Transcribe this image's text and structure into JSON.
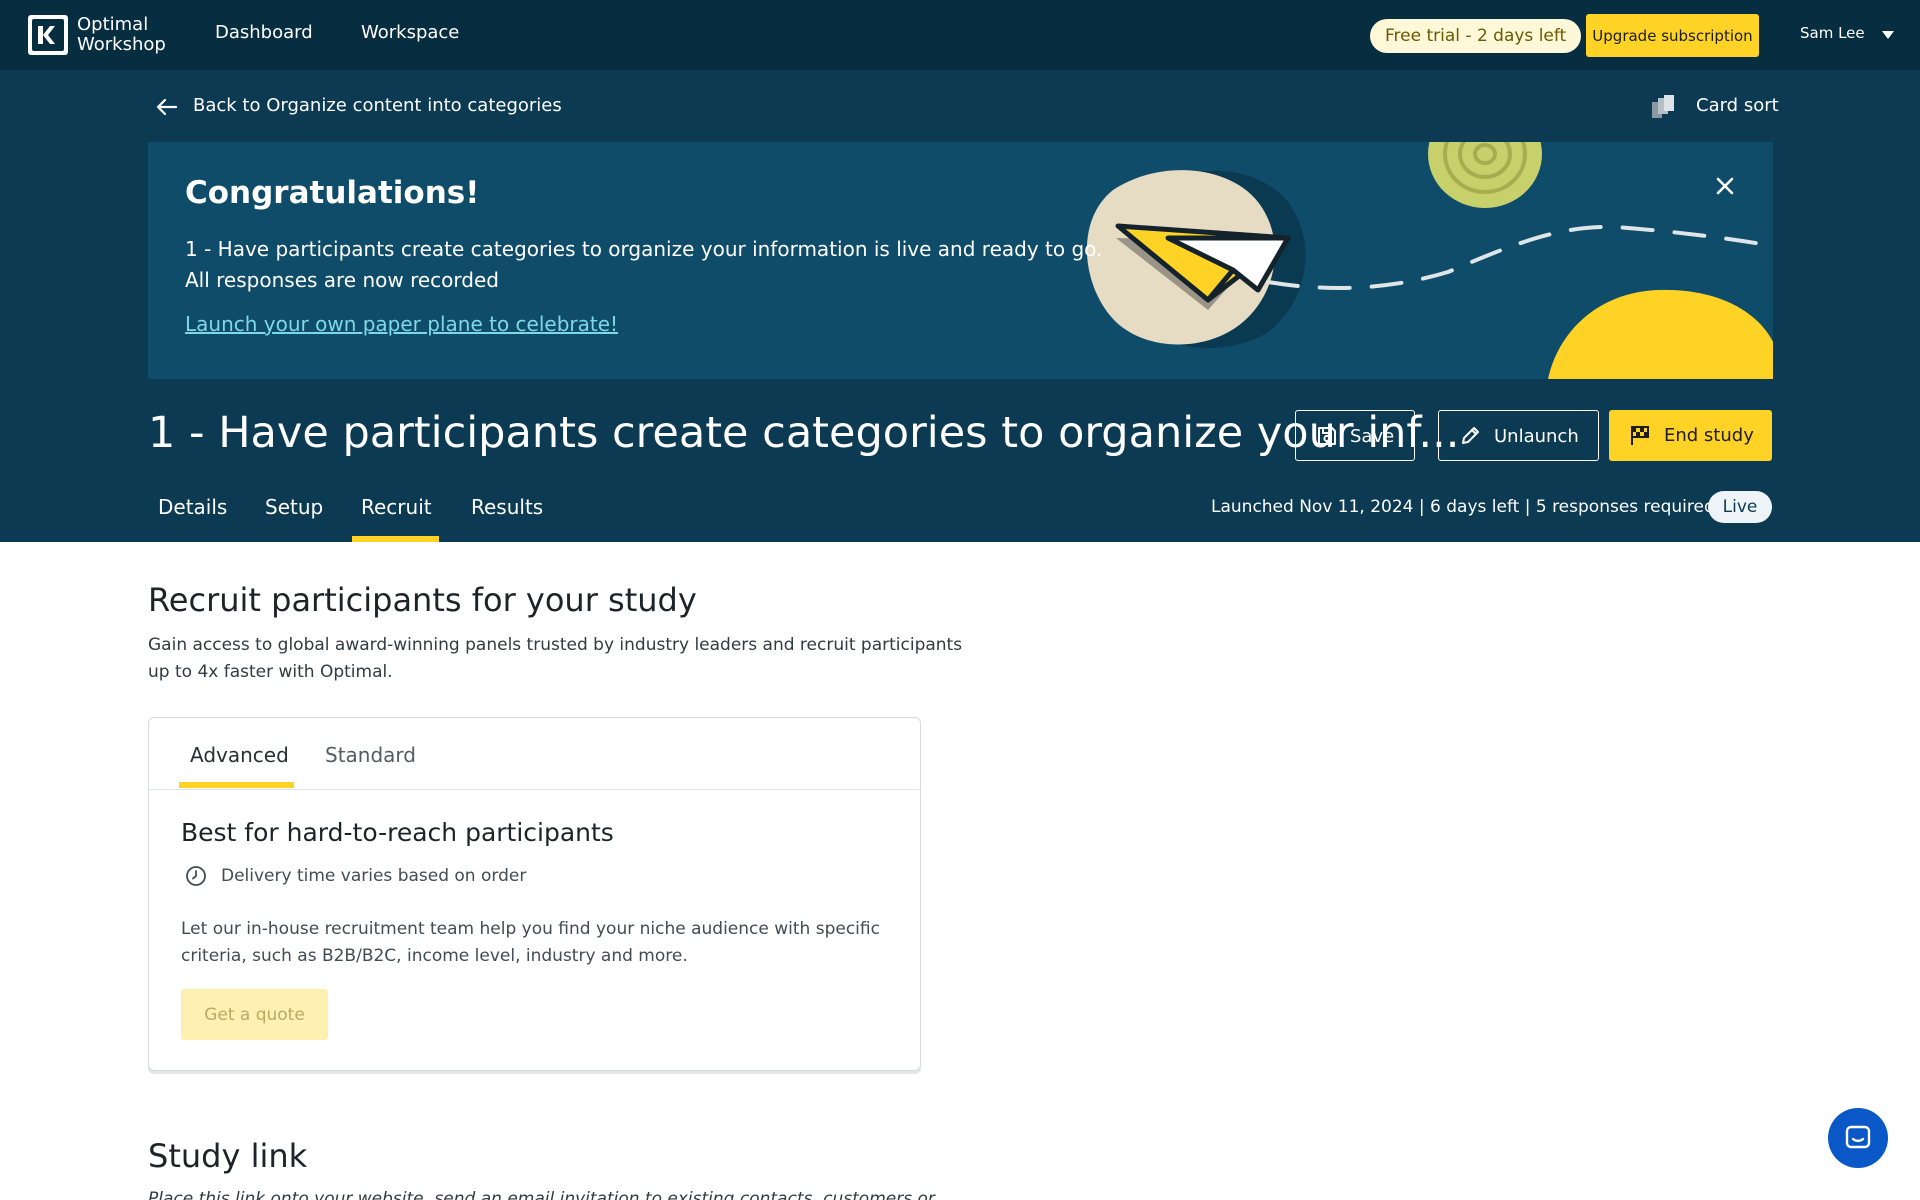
{
  "topnav": {
    "brand_line1": "Optimal",
    "brand_line2": "Workshop",
    "links": [
      "Dashboard",
      "Workspace"
    ],
    "trial_badge": "Free trial - 2 days left",
    "upgrade_label": "Upgrade subscription",
    "user_name": "Sam Lee"
  },
  "header": {
    "back_label": "Back to Organize content into categories",
    "study_type": "Card sort"
  },
  "banner": {
    "title": "Congratulations!",
    "line1": "1 - Have participants create categories to organize your information is live and ready to go.",
    "line2": "All responses are now recorded",
    "link": "Launch your own paper plane to celebrate!"
  },
  "study": {
    "title": "1 - Have participants create categories to organize your inf...",
    "save_label": "Save",
    "unlaunch_label": "Unlaunch",
    "end_label": "End study"
  },
  "tabs": {
    "items": [
      "Details",
      "Setup",
      "Recruit",
      "Results"
    ],
    "active": "Recruit",
    "meta": "Launched Nov 11, 2024 | 6 days left | 5 responses required",
    "status": "Live"
  },
  "recruit": {
    "title": "Recruit participants for your study",
    "desc_line1": "Gain access to global award-winning panels trusted by industry leaders and recruit participants",
    "desc_line2": "up to 4x faster with Optimal.",
    "card": {
      "tabs": [
        "Advanced",
        "Standard"
      ],
      "active_tab": "Advanced",
      "heading": "Best for hard-to-reach participants",
      "delivery": "Delivery time varies based on order",
      "body_line1": "Let our in-house recruitment team help you find your niche audience with specific",
      "body_line2": "criteria, such as B2B/B2C, income level, industry and more.",
      "cta": "Get a quote"
    }
  },
  "study_link": {
    "title": "Study link",
    "desc": "Place this link onto your website, send an email invitation to existing contacts, customers or"
  },
  "colors": {
    "nav_bg": "#072d40",
    "header_bg": "#0b3a52",
    "banner_bg": "#0f4c69",
    "accent_yellow": "#ffd325",
    "chat_blue": "#0a58c7"
  }
}
